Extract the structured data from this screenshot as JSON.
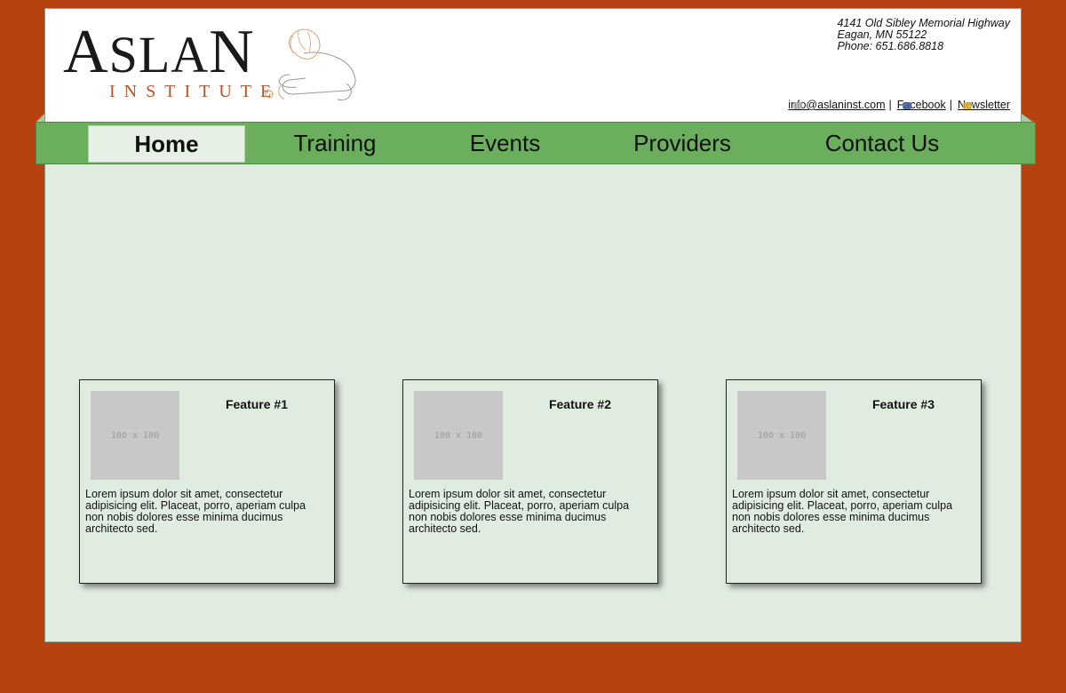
{
  "colors": {
    "background": "#b74211",
    "page": "#e1ece0",
    "nav": "#6aae5e",
    "nav_active": "#e6f0e4",
    "logo_accent": "#b5532a"
  },
  "logo": {
    "word": "ASLAN",
    "sub": "INSTITUTE",
    "icon": "lion-icon"
  },
  "header": {
    "address_line1": "4141 Old Sibley Memorial Highway",
    "address_line2": "Eagan, MN 55122",
    "phone": "Phone: 651.686.8818",
    "email": "info@aslaninst.com",
    "facebook": "Facebook",
    "newsletter": "Newsletter",
    "separator": "|"
  },
  "nav": {
    "items": [
      {
        "label": "Home",
        "active": true
      },
      {
        "label": "Training",
        "active": false
      },
      {
        "label": "Events",
        "active": false
      },
      {
        "label": "Providers",
        "active": false
      },
      {
        "label": "Contact Us",
        "active": false
      }
    ]
  },
  "features": [
    {
      "title": "Feature #1",
      "image_placeholder": "100 x 100",
      "text": "Lorem ipsum dolor sit amet, consectetur adipisicing elit. Placeat, porro, aperiam culpa non nobis dolores esse minima ducimus architecto sed."
    },
    {
      "title": "Feature #2",
      "image_placeholder": "100 x 100",
      "text": "Lorem ipsum dolor sit amet, consectetur adipisicing elit. Placeat, porro, aperiam culpa non nobis dolores esse minima ducimus architecto sed."
    },
    {
      "title": "Feature #3",
      "image_placeholder": "100 x 100",
      "text": "Lorem ipsum dolor sit amet, consectetur adipisicing elit. Placeat, porro, aperiam culpa non nobis dolores esse minima ducimus architecto sed."
    }
  ]
}
